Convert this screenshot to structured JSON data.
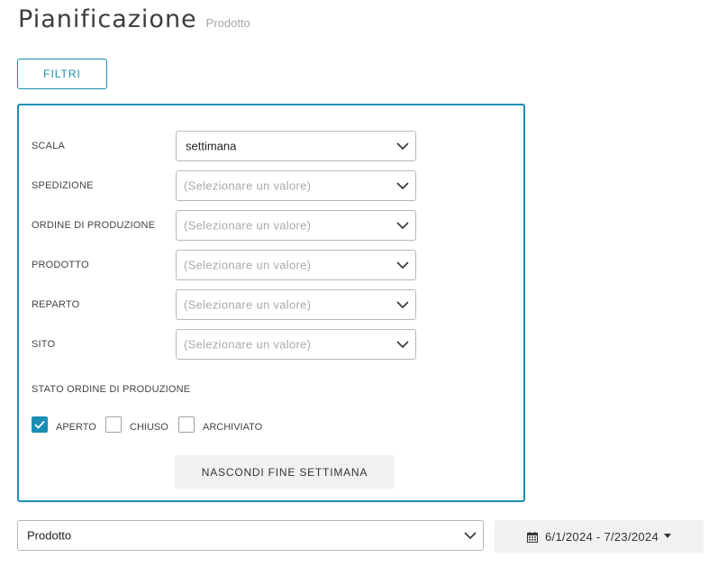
{
  "header": {
    "title": "Pianificazione",
    "subtitle": "Prodotto"
  },
  "filter_toggle": {
    "label": "FILTRI"
  },
  "filters": [
    {
      "label": "SCALA",
      "value": "settimana",
      "placeholder": ""
    },
    {
      "label": "SPEDIZIONE",
      "value": "",
      "placeholder": "(Selezionare un valore)"
    },
    {
      "label": "ORDINE DI PRODUZIONE",
      "value": "",
      "placeholder": "(Selezionare un valore)"
    },
    {
      "label": "PRODOTTO",
      "value": "",
      "placeholder": "(Selezionare un valore)"
    },
    {
      "label": "REPARTO",
      "value": "",
      "placeholder": "(Selezionare un valore)"
    },
    {
      "label": "SITO",
      "value": "",
      "placeholder": "(Selezionare un valore)"
    }
  ],
  "status": {
    "heading": "STATO ORDINE DI PRODUZIONE",
    "options": [
      {
        "label": "APERTO",
        "checked": true
      },
      {
        "label": "CHIUSO",
        "checked": false
      },
      {
        "label": "ARCHIVIATO",
        "checked": false
      }
    ]
  },
  "weekend_button": {
    "label": "NASCONDI FINE SETTIMANA"
  },
  "view_select": {
    "value": "Prodotto"
  },
  "date_range": {
    "label": "6/1/2024 - 7/23/2024",
    "icon": "calendar-icon"
  },
  "colors": {
    "accent": "#1a8fb3",
    "button_bg": "#f1f1f1"
  }
}
